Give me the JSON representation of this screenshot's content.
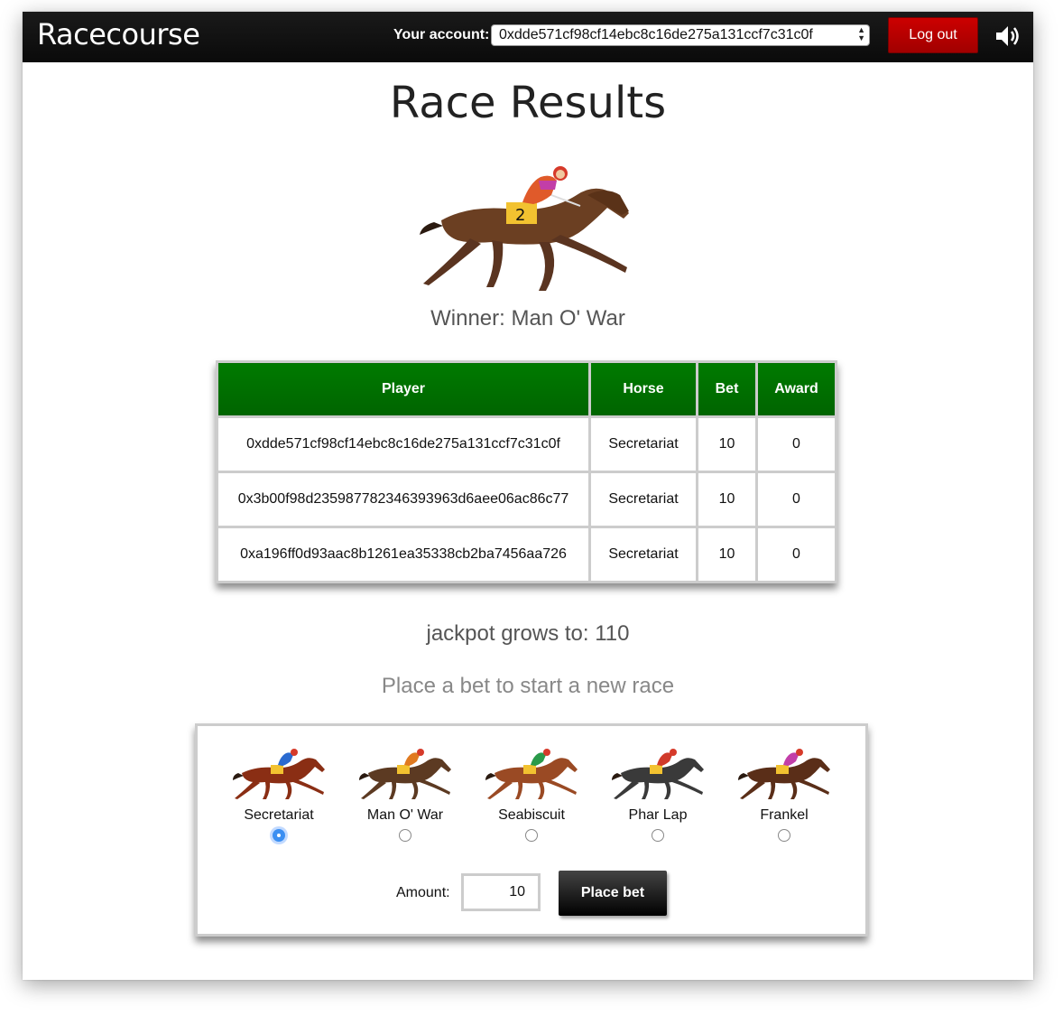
{
  "navbar": {
    "brand": "Racecourse",
    "account_label": "Your account:",
    "account_value": "0xdde571cf98cf14ebc8c16de275a131ccf7c31c0f",
    "logout_label": "Log out",
    "sound_icon": "speaker-icon"
  },
  "main": {
    "title": "Race Results",
    "winner_text": "Winner: Man O' War",
    "jackpot_text": "jackpot grows to: 110",
    "place_prompt": "Place a bet to start a new race"
  },
  "results_table": {
    "headers": [
      "Player",
      "Horse",
      "Bet",
      "Award"
    ],
    "rows": [
      [
        "0xdde571cf98cf14ebc8c16de275a131ccf7c31c0f",
        "Secretariat",
        "10",
        "0"
      ],
      [
        "0x3b00f98d235987782346393963d6aee06ac86c77",
        "Secretariat",
        "10",
        "0"
      ],
      [
        "0xa196ff0d93aac8b1261ea35338cb2ba7456aa726",
        "Secretariat",
        "10",
        "0"
      ]
    ]
  },
  "bet_form": {
    "horses": [
      {
        "name": "Secretariat",
        "selected": true
      },
      {
        "name": "Man O' War",
        "selected": false
      },
      {
        "name": "Seabiscuit",
        "selected": false
      },
      {
        "name": "Phar Lap",
        "selected": false
      },
      {
        "name": "Frankel",
        "selected": false
      }
    ],
    "amount_label": "Amount:",
    "amount_value": "10",
    "place_bet_label": "Place bet"
  },
  "colors": {
    "navbar": "#111111",
    "logout": "#c00000",
    "table_header": "#007000",
    "radio_selected": "#3b8ff2"
  }
}
